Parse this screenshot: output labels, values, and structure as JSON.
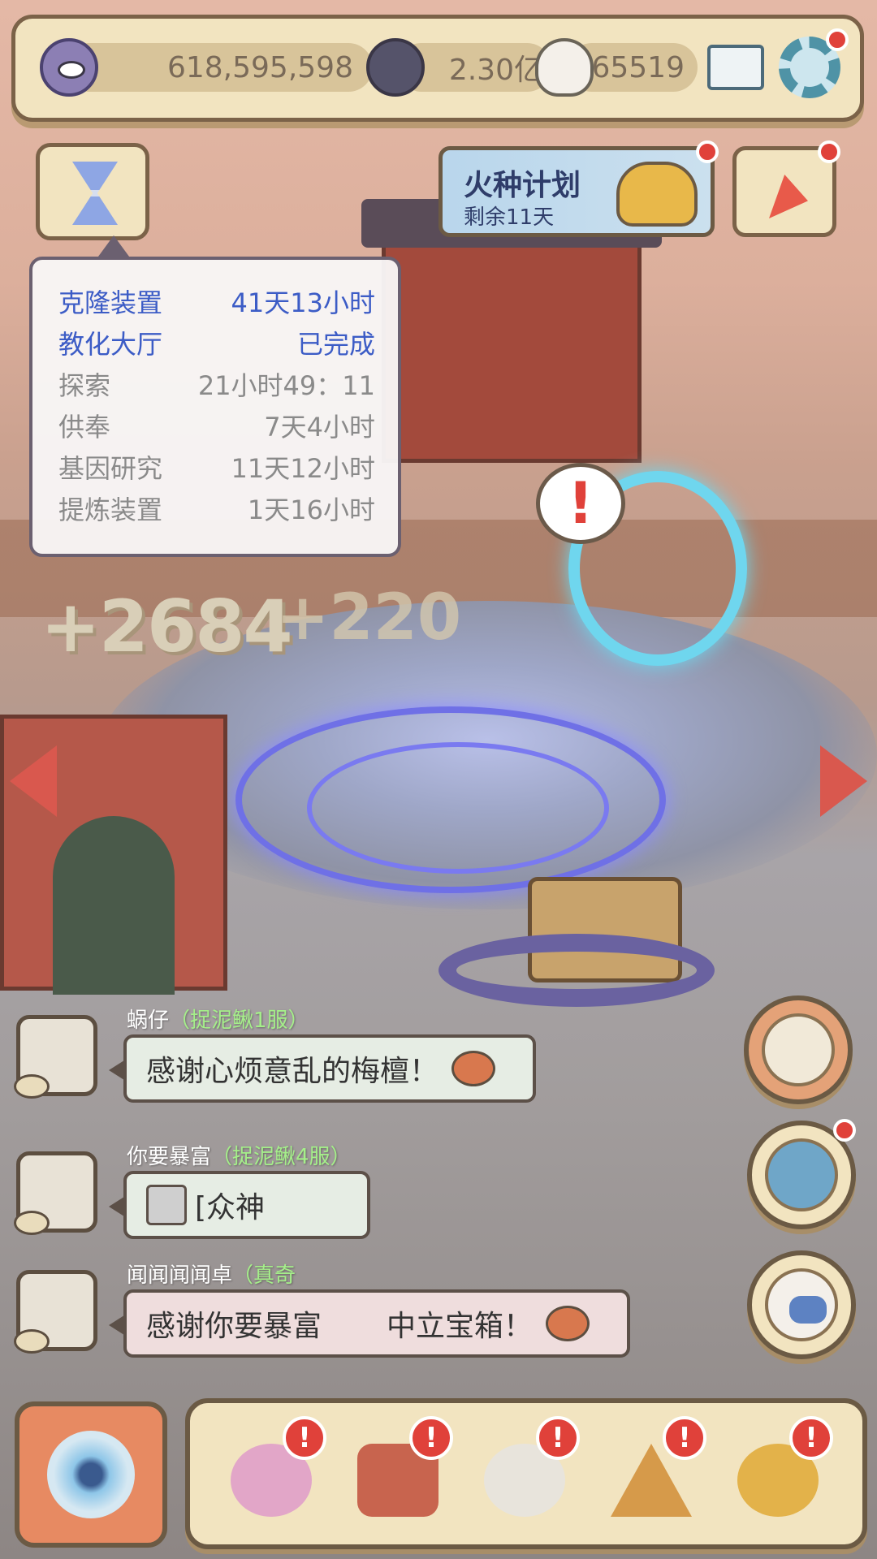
{
  "topbar": {
    "eye_count": "618,595,598",
    "soul_count": "2.30亿",
    "ghost_count": "65519",
    "mail_icon": "mail-icon",
    "settings_icon": "gear-icon"
  },
  "event": {
    "title": "火种计划",
    "subtitle": "剩余11天"
  },
  "timers": [
    {
      "name": "克隆装置",
      "time": "41天13小时"
    },
    {
      "name": "教化大厅",
      "time": "已完成"
    },
    {
      "name": "探索",
      "time": "21小时49：11"
    },
    {
      "name": "供奉",
      "time": "7天4小时"
    },
    {
      "name": "基因研究",
      "time": "11天12小时"
    },
    {
      "name": "提炼装置",
      "time": "1天16小时"
    }
  ],
  "floating_numbers": [
    "+2684",
    "+220"
  ],
  "chat": [
    {
      "user": "蜗仔",
      "server": "（捉泥鳅1服）",
      "message": "感谢心烦意乱的梅檀！"
    },
    {
      "user": "你要暴富",
      "server": "（捉泥鳅4服）",
      "message": "[众神"
    },
    {
      "user": "闻闻闻闻卓",
      "server": "（真奇",
      "message": "感谢你要暴富",
      "message_tail": "中立宝箱！"
    }
  ],
  "dock": {
    "badge_symbol": "!",
    "items": [
      "snail-icon",
      "backpack-icon",
      "statue-icon",
      "pyramid-eye-icon",
      "coin-key-icon"
    ]
  },
  "colors": {
    "accent_blue": "#3c5cc6",
    "alert_red": "#e0413a",
    "panel_cream": "#f2e4c0",
    "server_green": "#a5ef8a"
  }
}
